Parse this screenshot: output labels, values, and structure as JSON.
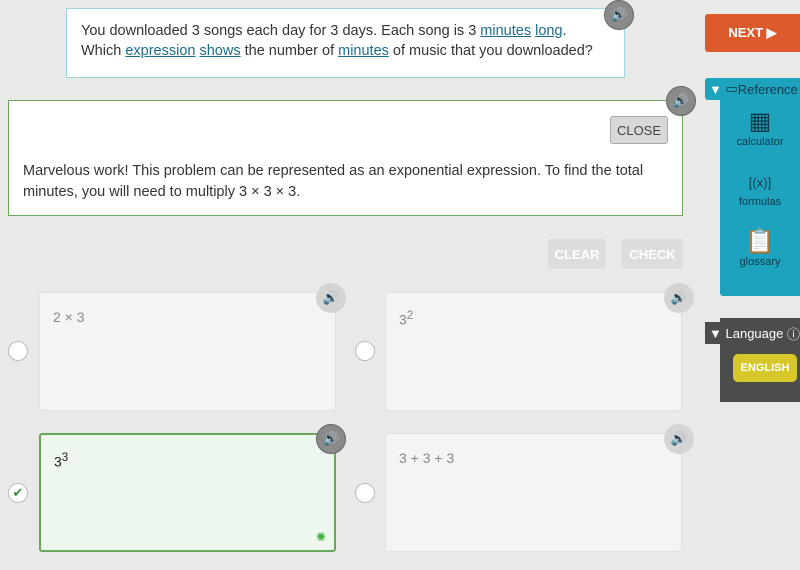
{
  "question": {
    "parts": [
      "You downloaded 3 songs each day for 3 days. Each song is 3 ",
      "minutes",
      " ",
      "long",
      ".",
      "Which ",
      "expression",
      " ",
      "shows",
      " the number of ",
      "minutes",
      " of music that you downloaded?"
    ]
  },
  "feedback": {
    "close_label": "CLOSE",
    "text": "Marvelous work! This problem can be represented as an exponential expression. To find the total minutes, you will need to multiply 3 × 3 × 3."
  },
  "actions": {
    "clear": "CLEAR",
    "check": "CHECK"
  },
  "choices": [
    {
      "base": "2 × 3",
      "sup": "",
      "selected": false
    },
    {
      "base": "3",
      "sup": "2",
      "selected": false
    },
    {
      "base": "3",
      "sup": "3",
      "selected": true
    },
    {
      "base": "3 + 3 + 3",
      "sup": "",
      "selected": false
    }
  ],
  "sidebar": {
    "next": "NEXT ▶",
    "reference": "Reference",
    "tools": [
      {
        "label": "calculator",
        "icon": "calculator-icon"
      },
      {
        "label": "formulas",
        "icon": "formulas-icon"
      },
      {
        "label": "glossary",
        "icon": "clipboard-icon"
      }
    ],
    "language": "Language",
    "english": "ENGLISH"
  },
  "colors": {
    "accent": "#1ea3bf",
    "next": "#dd5a2d",
    "correct": "#6aa65c",
    "english": "#d6c82a"
  }
}
